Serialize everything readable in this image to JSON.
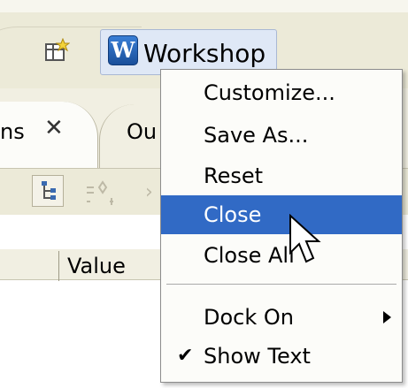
{
  "perspective_bar": {
    "workshop_label": "Workshop",
    "icons": {
      "open_perspective": "open-perspective-icon",
      "workshop": "workshop-perspective-icon"
    }
  },
  "views": {
    "left_tab_label": "ns",
    "right_tab_label": "Ou",
    "close_icon": "close-icon"
  },
  "table": {
    "value_column": "Value"
  },
  "context_menu": {
    "items": [
      {
        "label": "Customize..."
      },
      {
        "label": "Save As..."
      },
      {
        "label": "Reset"
      },
      {
        "label": "Close",
        "selected": true
      },
      {
        "label": "Close All"
      },
      {
        "label": "Dock On",
        "submenu": true
      },
      {
        "label": "Show Text",
        "checked": true
      }
    ]
  },
  "colors": {
    "selection": "#316ac5",
    "menu_bg": "#fcfcf9",
    "chrome_bg": "#f1efe2"
  }
}
